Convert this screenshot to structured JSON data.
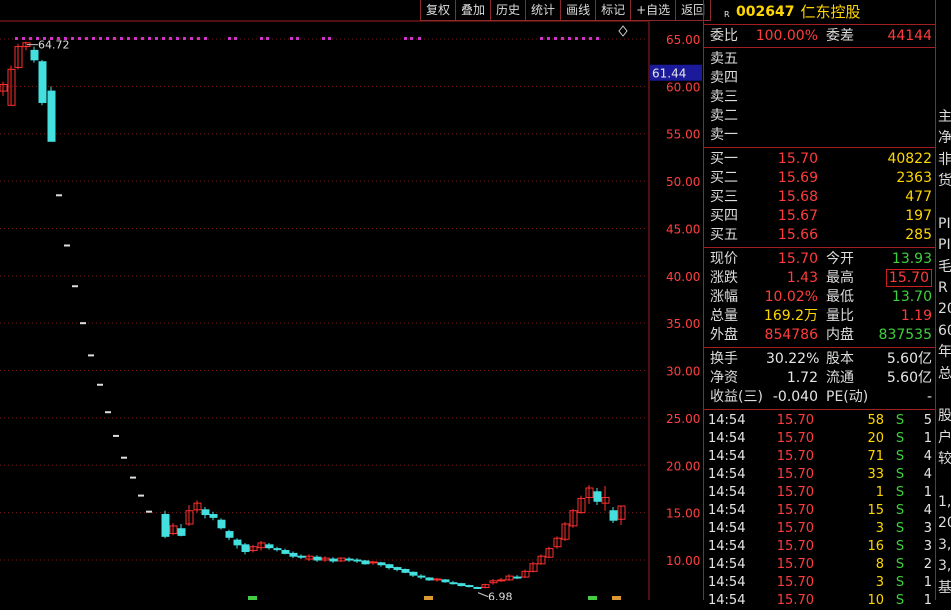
{
  "toolbar": [
    "复权",
    "叠加",
    "历史",
    "统计",
    "画线",
    "标记",
    "+自选",
    "返回"
  ],
  "chart": {
    "price_labels": [
      "65.00",
      "60.00",
      "55.00",
      "50.00",
      "45.00",
      "40.00",
      "35.00",
      "30.00",
      "25.00",
      "20.00",
      "15.00",
      "10.00"
    ],
    "current_price_label": "61.44",
    "high_label": "64.72",
    "low_label": "6.98",
    "colors": {
      "up": "#ff3030",
      "down": "#44e0e0",
      "grid": "#7a1a1a",
      "axis": "#a02020",
      "marker": "#cc33cc",
      "dash": "#dddddd"
    }
  },
  "quote": {
    "badge": "R",
    "code": "002647",
    "name": "仁东控股",
    "weibi_label": "委比",
    "weibi": "100.00%",
    "weicha_label": "委差",
    "weicha": "44144",
    "sell": [
      {
        "label": "卖五",
        "price": "",
        "vol": ""
      },
      {
        "label": "卖四",
        "price": "",
        "vol": ""
      },
      {
        "label": "卖三",
        "price": "",
        "vol": ""
      },
      {
        "label": "卖二",
        "price": "",
        "vol": ""
      },
      {
        "label": "卖一",
        "price": "",
        "vol": ""
      }
    ],
    "buy": [
      {
        "label": "买一",
        "price": "15.70",
        "vol": "40822"
      },
      {
        "label": "买二",
        "price": "15.69",
        "vol": "2363"
      },
      {
        "label": "买三",
        "price": "15.68",
        "vol": "477"
      },
      {
        "label": "买四",
        "price": "15.67",
        "vol": "197"
      },
      {
        "label": "买五",
        "price": "15.66",
        "vol": "285"
      }
    ],
    "stats": [
      {
        "l1": "现价",
        "v1": "15.70",
        "c1": "red",
        "l2": "今开",
        "v2": "13.93",
        "c2": "green",
        "box2": false
      },
      {
        "l1": "涨跌",
        "v1": "1.43",
        "c1": "red",
        "l2": "最高",
        "v2": "15.70",
        "c2": "red",
        "box2": true
      },
      {
        "l1": "涨幅",
        "v1": "10.02%",
        "c1": "red",
        "l2": "最低",
        "v2": "13.70",
        "c2": "green",
        "box2": false
      },
      {
        "l1": "总量",
        "v1": "169.2万",
        "c1": "yellow",
        "l2": "量比",
        "v2": "1.19",
        "c2": "red",
        "box2": false
      },
      {
        "l1": "外盘",
        "v1": "854786",
        "c1": "red",
        "l2": "内盘",
        "v2": "837535",
        "c2": "green",
        "box2": false
      }
    ],
    "fundamentals": [
      {
        "l1": "换手",
        "v1": "30.22%",
        "l2": "股本",
        "v2": "5.60亿"
      },
      {
        "l1": "净资",
        "v1": "1.72",
        "l2": "流通",
        "v2": "5.60亿"
      },
      {
        "l1": "收益(三)",
        "v1": "-0.040",
        "l2": "PE(动)",
        "v2": "-"
      }
    ],
    "ticks": [
      {
        "t": "14:54",
        "p": "15.70",
        "v": "58",
        "s": "S",
        "n": "5"
      },
      {
        "t": "14:54",
        "p": "15.70",
        "v": "20",
        "s": "S",
        "n": "1"
      },
      {
        "t": "14:54",
        "p": "15.70",
        "v": "71",
        "s": "S",
        "n": "4"
      },
      {
        "t": "14:54",
        "p": "15.70",
        "v": "33",
        "s": "S",
        "n": "4"
      },
      {
        "t": "14:54",
        "p": "15.70",
        "v": "1",
        "s": "S",
        "n": "1"
      },
      {
        "t": "14:54",
        "p": "15.70",
        "v": "15",
        "s": "S",
        "n": "4"
      },
      {
        "t": "14:54",
        "p": "15.70",
        "v": "3",
        "s": "S",
        "n": "3"
      },
      {
        "t": "14:54",
        "p": "15.70",
        "v": "16",
        "s": "S",
        "n": "3"
      },
      {
        "t": "14:54",
        "p": "15.70",
        "v": "8",
        "s": "S",
        "n": "2"
      },
      {
        "t": "14:54",
        "p": "15.70",
        "v": "3",
        "s": "S",
        "n": "1"
      },
      {
        "t": "14:54",
        "p": "15.70",
        "v": "10",
        "s": "S",
        "n": "1"
      }
    ]
  },
  "edge_chars": [
    "",
    "",
    "",
    "",
    "",
    "主",
    "净",
    "非",
    "货",
    "",
    "PI",
    "PI",
    "毛",
    "R",
    "20",
    "60",
    "年",
    "总",
    "",
    "股",
    "户",
    "较",
    "",
    "1,",
    "20",
    "3,",
    "3,",
    "基"
  ]
}
